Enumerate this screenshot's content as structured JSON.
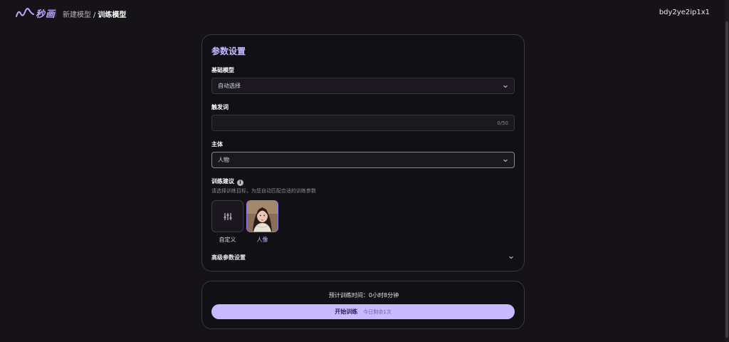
{
  "header": {
    "logo_text": "秒画",
    "breadcrumb": [
      "新建模型",
      "训练模型"
    ],
    "breadcrumb_separator": "/",
    "username": "bdy2ye2ip1x1"
  },
  "params": {
    "title": "参数设置",
    "base_model": {
      "label": "基础模型",
      "value": "自动选择"
    },
    "trigger_word": {
      "label": "触发词",
      "value": "",
      "counter": "0/50"
    },
    "subject": {
      "label": "主体",
      "value": "人物"
    },
    "suggestion": {
      "label": "训练建议",
      "hint": "请选择训练目标，为您自动匹配合适的训练参数",
      "options": [
        {
          "label": "自定义",
          "icon": "sliders-icon",
          "selected": false
        },
        {
          "label": "人像",
          "icon": "portrait-thumbnail",
          "selected": true
        }
      ]
    },
    "advanced_label": "高级参数设置"
  },
  "training": {
    "eta": "预计训练时间：0小时8分钟",
    "start_label": "开始训练",
    "remaining": "今日剩余1次"
  },
  "colors": {
    "accent": "#c9b9ff",
    "title": "#c7b8ff",
    "background": "#161318",
    "panel": "#111015"
  }
}
